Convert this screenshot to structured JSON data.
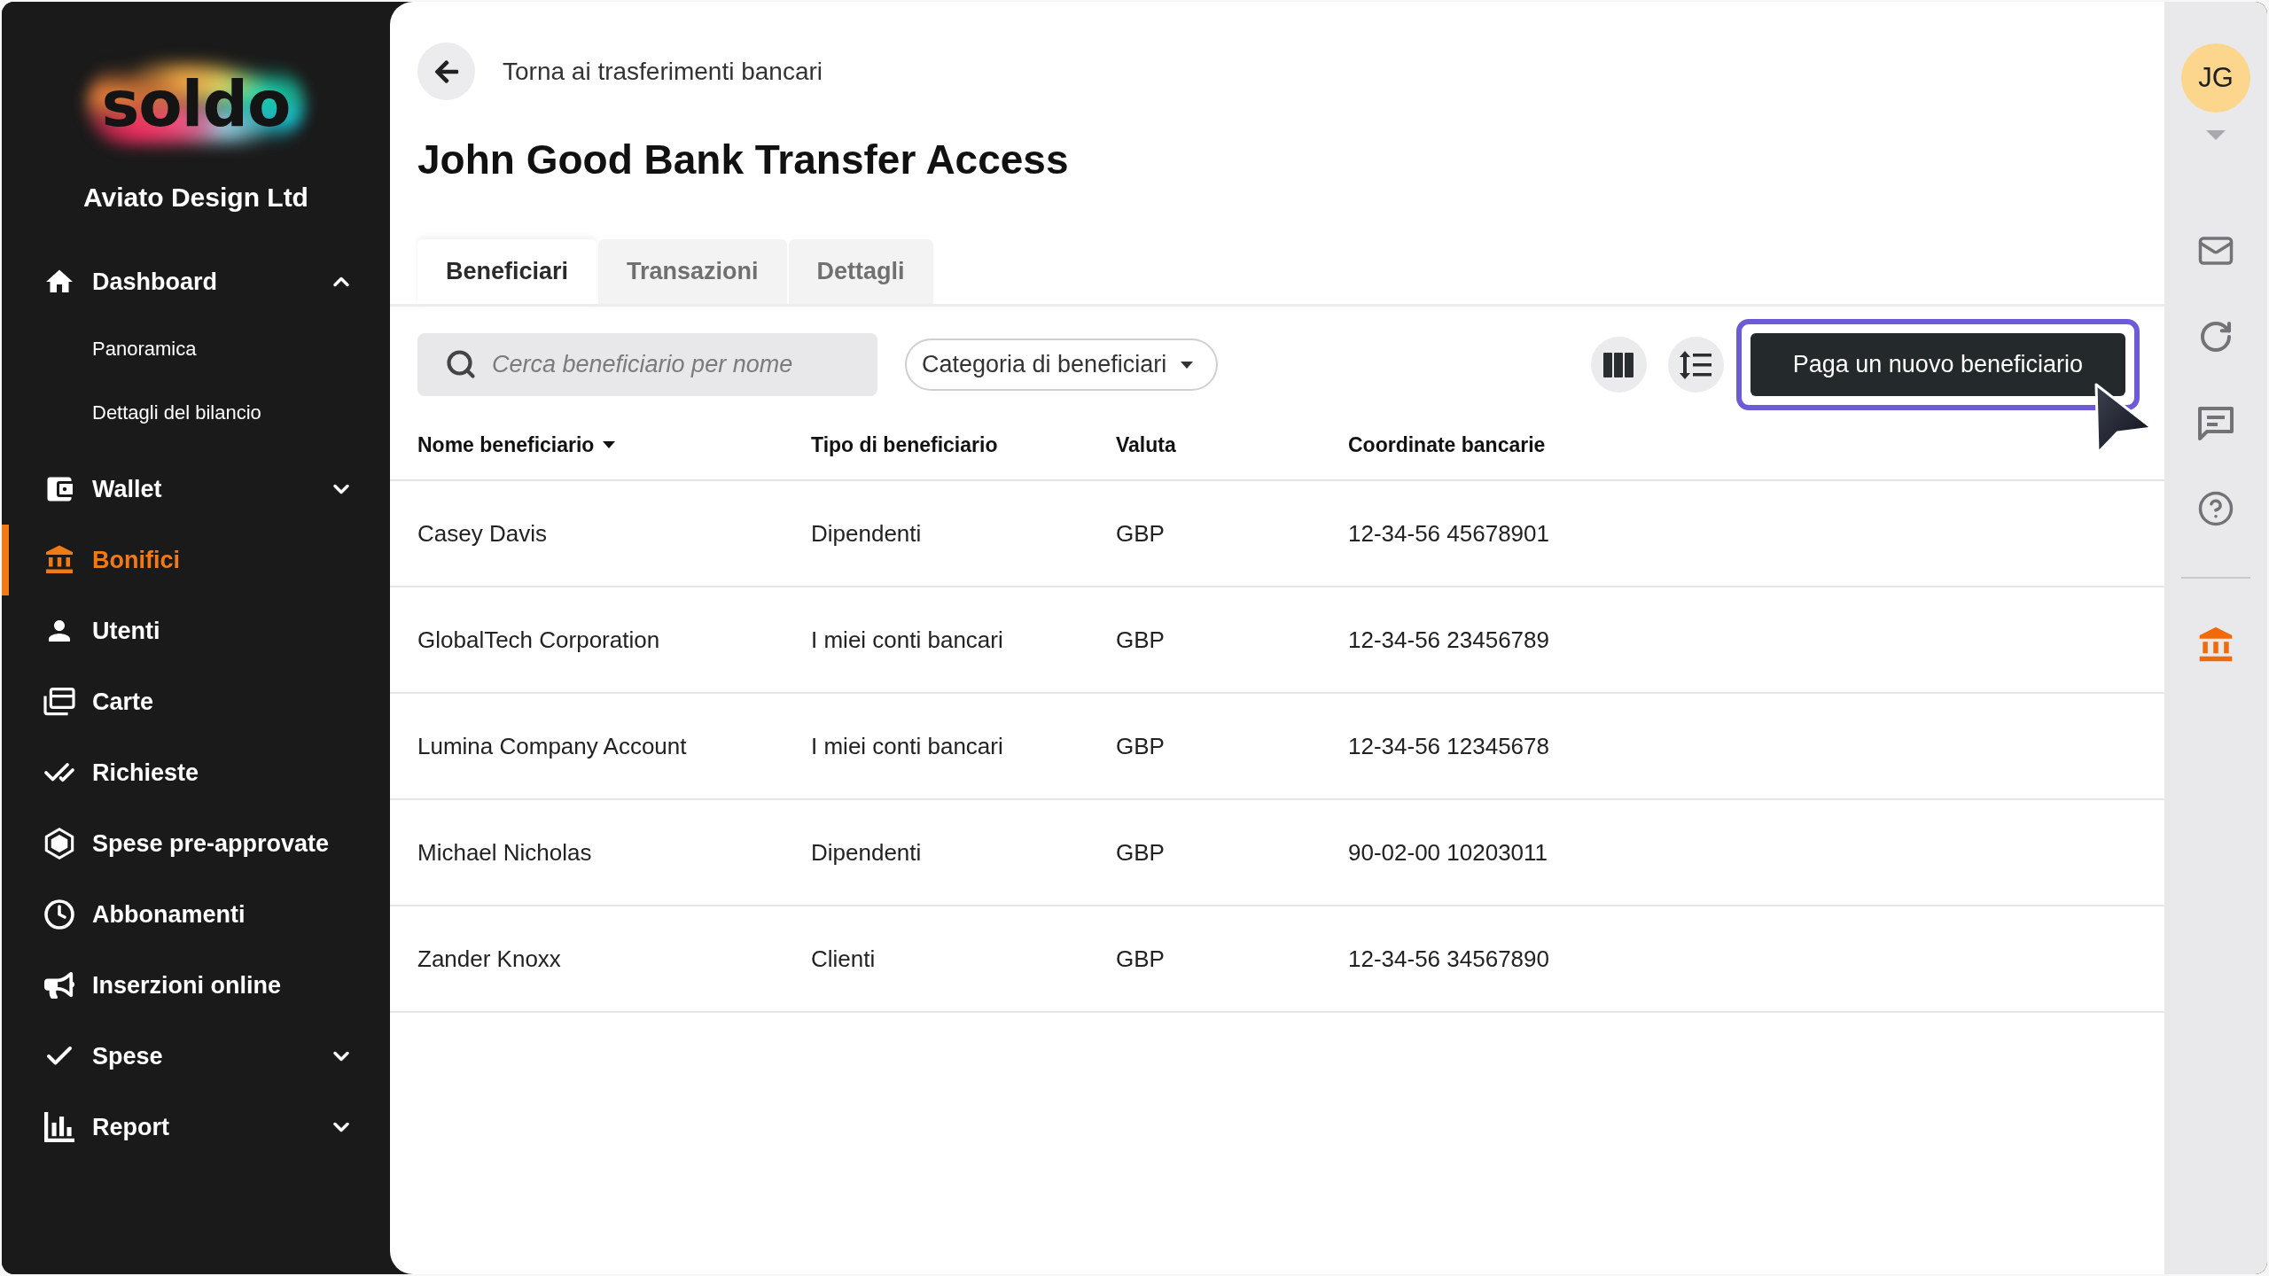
{
  "sidebar": {
    "logo": "soldo",
    "company": "Aviato Design Ltd",
    "items": [
      {
        "label": "Dashboard",
        "selected": false,
        "expanded": true,
        "children": [
          {
            "label": "Panoramica",
            "selected": false
          },
          {
            "label": "Dettagli del bilancio",
            "selected": false
          }
        ]
      },
      {
        "label": "Wallet",
        "selected": false,
        "expanded": false
      },
      {
        "label": "Bonifici",
        "selected": true
      },
      {
        "label": "Utenti",
        "selected": false
      },
      {
        "label": "Carte",
        "selected": false
      },
      {
        "label": "Richieste",
        "selected": false
      },
      {
        "label": "Spese pre-approvate",
        "selected": false
      },
      {
        "label": "Abbonamenti",
        "selected": false
      },
      {
        "label": "Inserzioni online",
        "selected": false
      },
      {
        "label": "Spese",
        "selected": false,
        "expanded": false
      },
      {
        "label": "Report",
        "selected": false,
        "expanded": false
      }
    ]
  },
  "header": {
    "back_link": "Torna ai trasferimenti bancari",
    "title": "John Good Bank Transfer Access"
  },
  "tabs": [
    {
      "label": "Beneficiari",
      "selected": true
    },
    {
      "label": "Transazioni",
      "selected": false
    },
    {
      "label": "Dettagli",
      "selected": false
    }
  ],
  "toolbar": {
    "search": {
      "placeholder": "Cerca beneficiario per nome"
    },
    "filter": {
      "label": "Categoria di beneficiari"
    },
    "primary_button": {
      "label": "Paga un nuovo beneficiario",
      "focused": true
    }
  },
  "table": {
    "columns": [
      {
        "label": "Nome beneficiario",
        "sorted": true
      },
      {
        "label": "Tipo di beneficiario",
        "sorted": false
      },
      {
        "label": "Valuta",
        "sorted": false
      },
      {
        "label": "Coordinate bancarie",
        "sorted": false
      }
    ],
    "rows": [
      [
        "Casey Davis",
        "Dipendenti",
        "GBP",
        "12-34-56 45678901"
      ],
      [
        "GlobalTech Corporation",
        "I miei conti bancari",
        "GBP",
        "12-34-56 23456789"
      ],
      [
        "Lumina Company Account",
        "I miei conti bancari",
        "GBP",
        "12-34-56 12345678"
      ],
      [
        "Michael Nicholas",
        "Dipendenti",
        "GBP",
        "90-02-00 10203011"
      ],
      [
        "Zander Knoxx",
        "Clienti",
        "GBP",
        "12-34-56 34567890"
      ]
    ]
  },
  "right_rail": {
    "avatar": "JG",
    "tools": [
      {
        "selected": false
      },
      {
        "selected": false
      },
      {
        "selected": false
      },
      {
        "selected": false
      },
      {
        "selected": true
      }
    ]
  }
}
